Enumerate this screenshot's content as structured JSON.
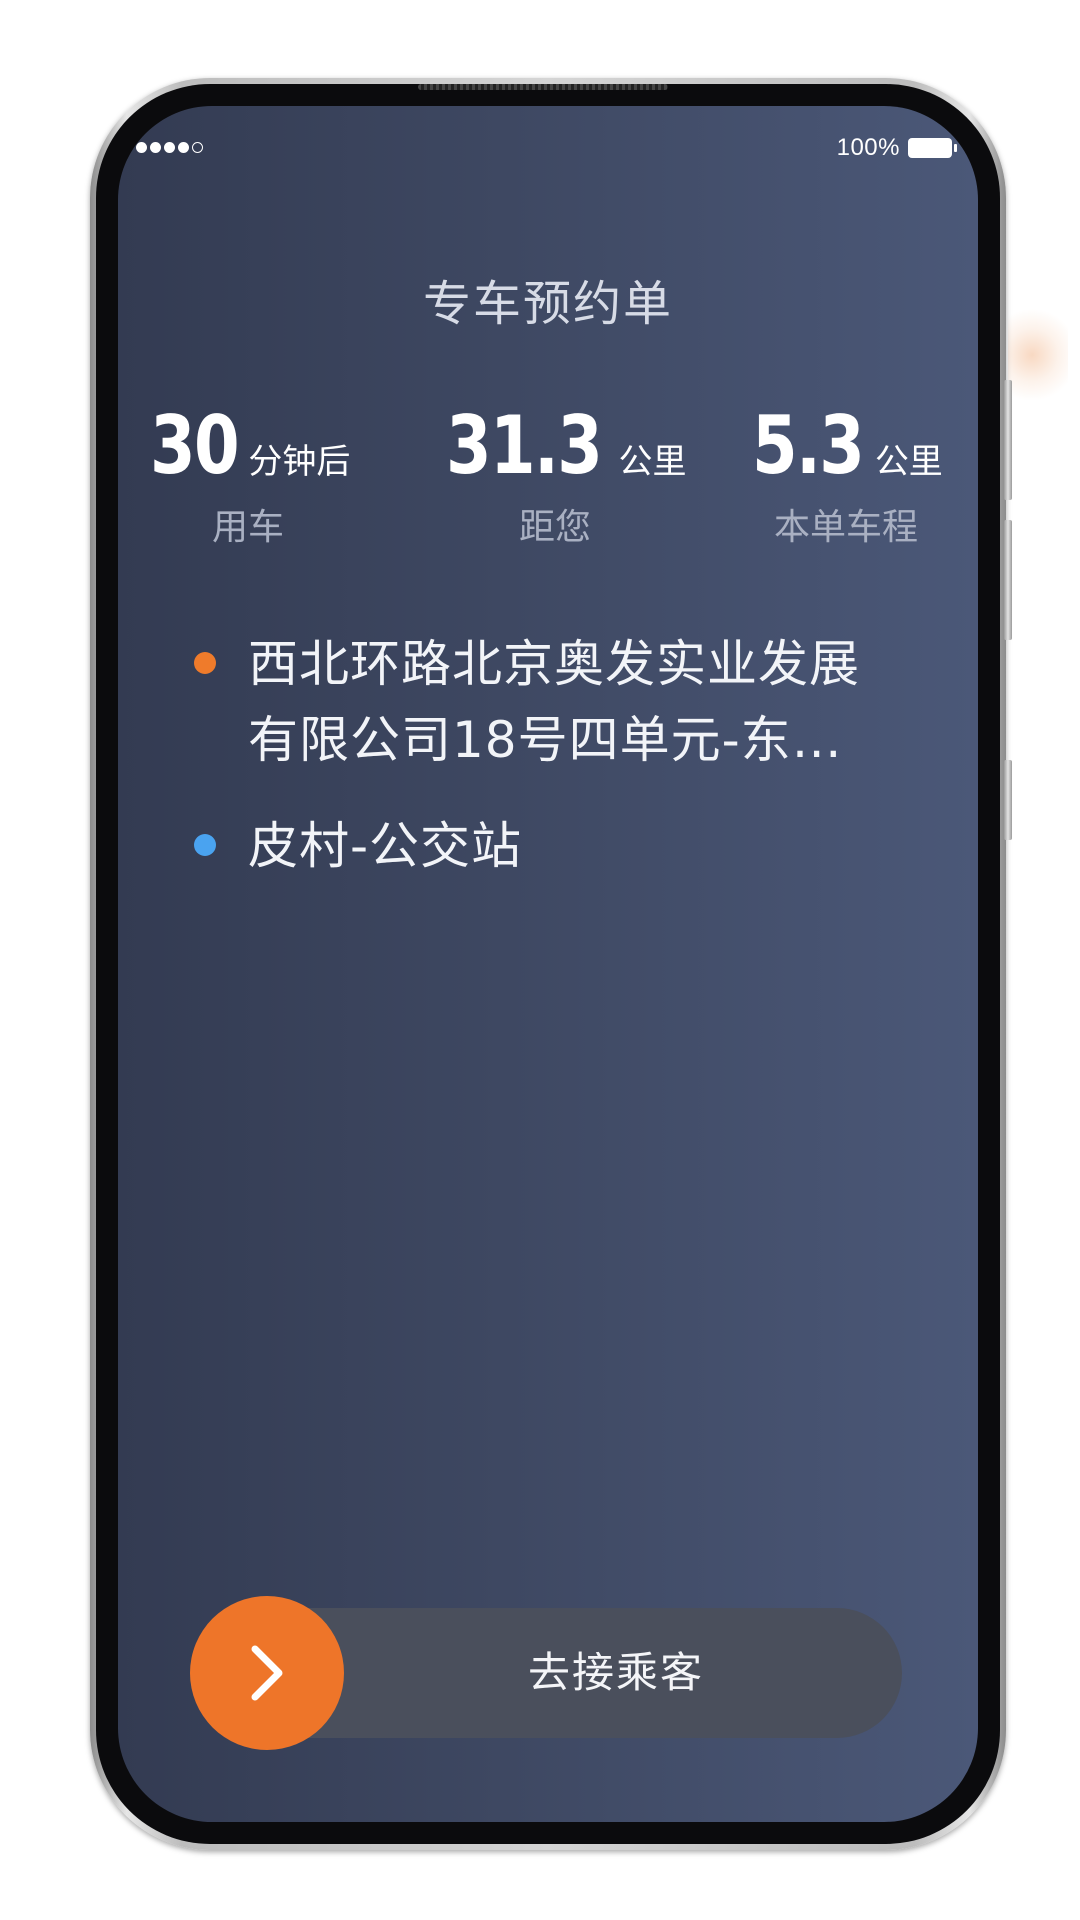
{
  "status_bar": {
    "signal_dots_filled": 4,
    "signal_dots_total": 5,
    "battery_text": "100%",
    "battery_level": 1.0
  },
  "title": "专车预约单",
  "stats": [
    {
      "value": "30",
      "unit": "分钟后",
      "label": "用车"
    },
    {
      "value": "31.3",
      "unit": "公里",
      "label": "距您"
    },
    {
      "value": "5.3",
      "unit": "公里",
      "label": "本单车程"
    }
  ],
  "route": {
    "start": {
      "line1": "西北环路北京奥发实业发展",
      "line2": "有限公司18号四单元-东…",
      "dot_color": "#ef7b2b"
    },
    "end": {
      "line1": "皮村-公交站",
      "dot_color": "#4aa3f0"
    }
  },
  "slider": {
    "label": "去接乘客",
    "knob_color": "#ee7529",
    "knob_icon": "chevron-right-icon"
  },
  "colors": {
    "screen_bg_left": "#333b52",
    "screen_bg_right": "#4b5878",
    "accent": "#ee7529"
  }
}
